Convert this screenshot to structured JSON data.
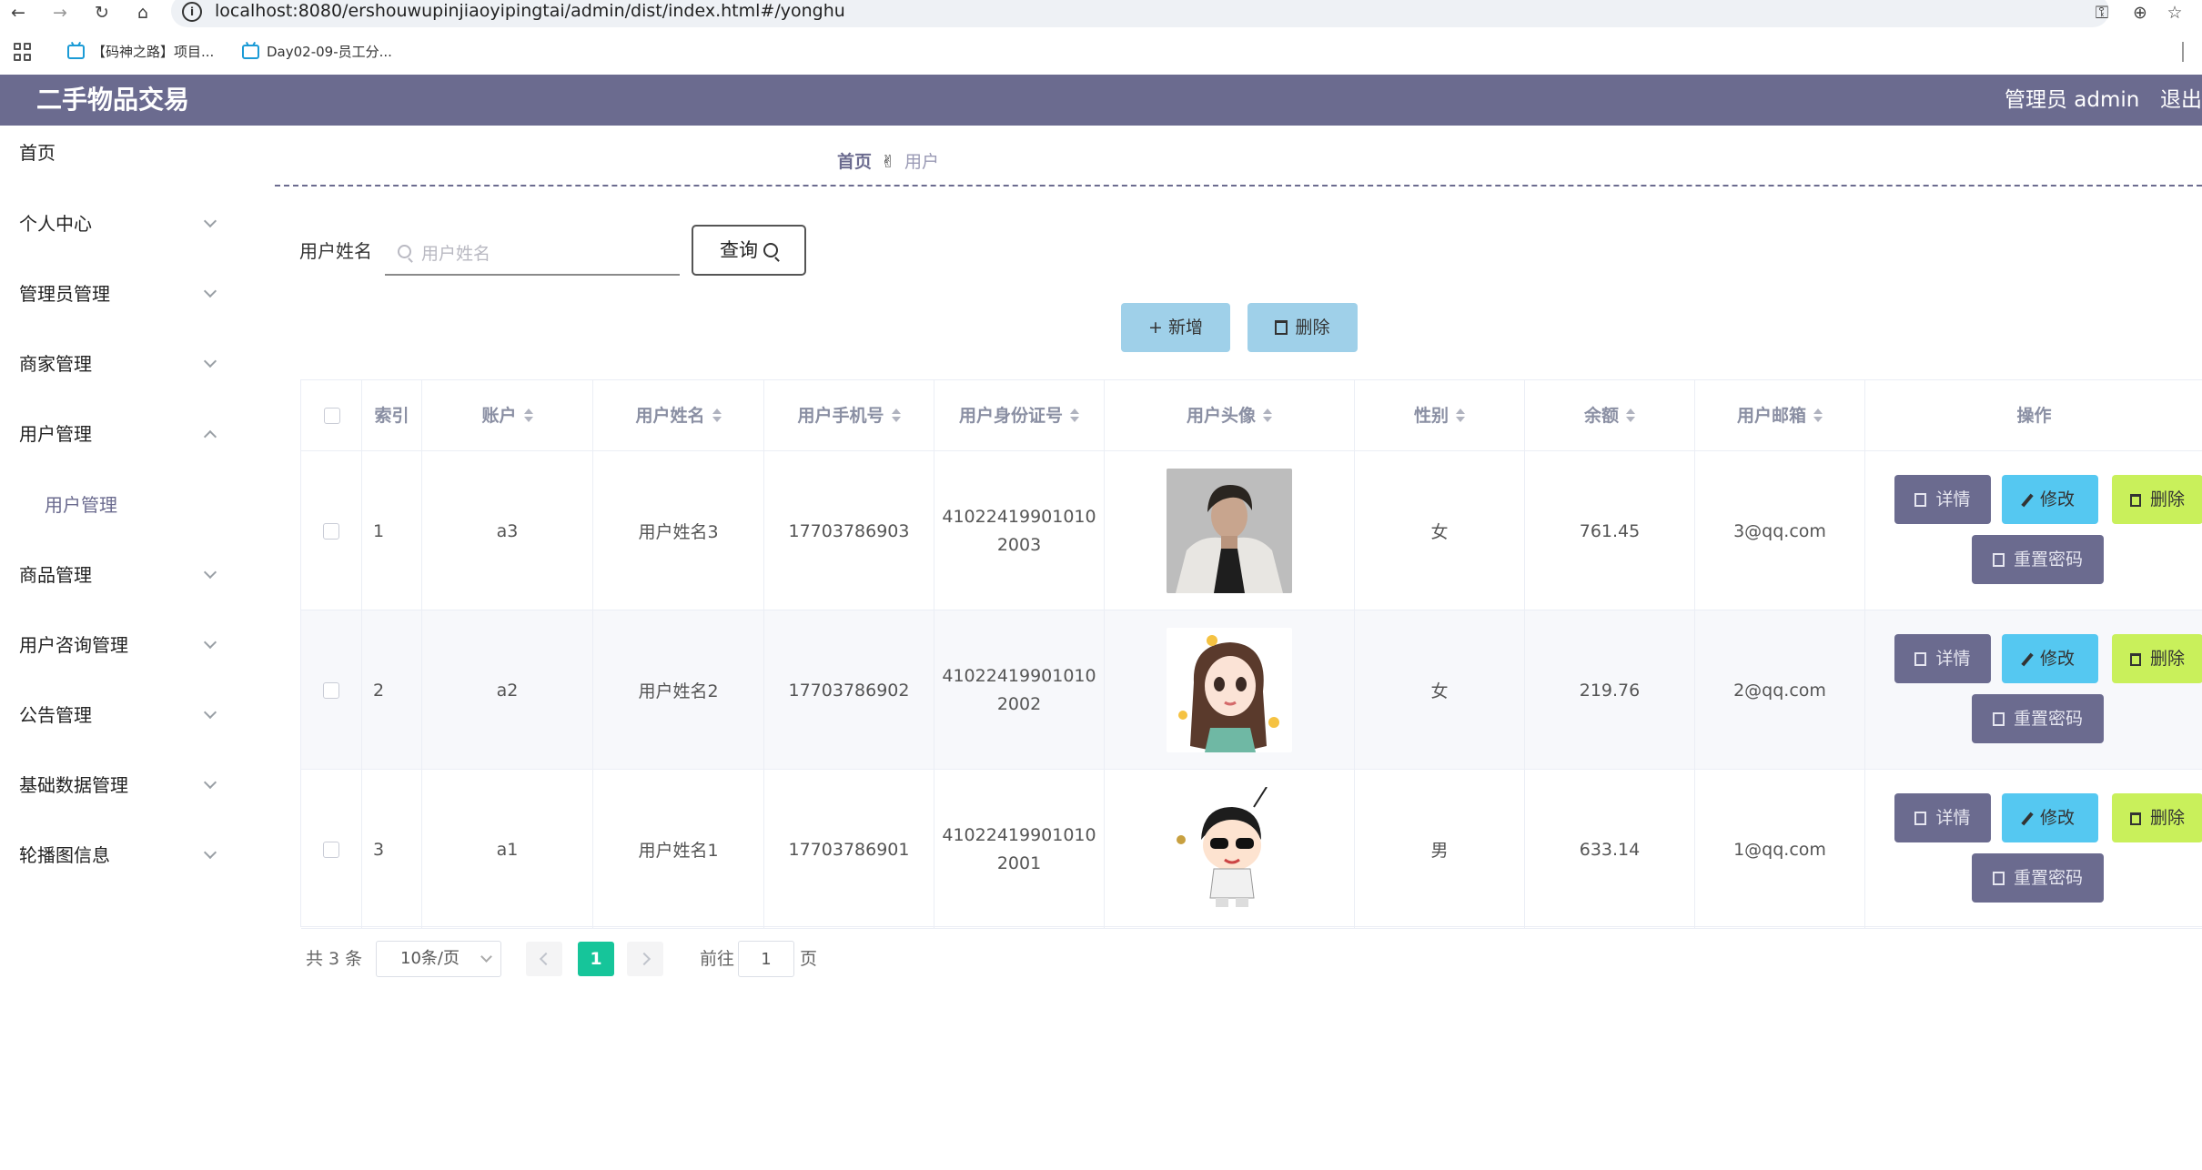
{
  "browser": {
    "url": "localhost:8080/ershouwupinjiaoyipingtai/admin/dist/index.html#/yonghu",
    "bookmarks": [
      {
        "label": "【码神之路】项目..."
      },
      {
        "label": "Day02-09-员工分..."
      }
    ]
  },
  "header": {
    "title": "二手物品交易",
    "admin_label": "管理员 admin",
    "logout_label": "退出"
  },
  "sidebar": {
    "items": [
      {
        "label": "首页"
      },
      {
        "label": "个人中心"
      },
      {
        "label": "管理员管理"
      },
      {
        "label": "商家管理"
      },
      {
        "label": "用户管理"
      },
      {
        "label": "商品管理"
      },
      {
        "label": "用户咨询管理"
      },
      {
        "label": "公告管理"
      },
      {
        "label": "基础数据管理"
      },
      {
        "label": "轮播图信息"
      }
    ],
    "submenu": {
      "label": "用户管理"
    }
  },
  "breadcrumb": {
    "home": "首页",
    "separator_glyph": "✌",
    "current": "用户"
  },
  "search": {
    "label": "用户姓名",
    "placeholder": "用户姓名",
    "query_label": "查询"
  },
  "actions": {
    "add_label": "新增",
    "delete_label": "删除"
  },
  "table": {
    "headers": {
      "index": "索引",
      "account": "账户",
      "name": "用户姓名",
      "phone": "用户手机号",
      "idcard": "用户身份证号",
      "avatar": "用户头像",
      "gender": "性别",
      "balance": "余额",
      "email": "用户邮箱",
      "ops": "操作"
    },
    "rows": [
      {
        "index": "1",
        "account": "a3",
        "name": "用户姓名3",
        "phone": "17703786903",
        "idcard_a": "41022419901010",
        "idcard_b": "2003",
        "gender": "女",
        "balance": "761.45",
        "email": "3@qq.com"
      },
      {
        "index": "2",
        "account": "a2",
        "name": "用户姓名2",
        "phone": "17703786902",
        "idcard_a": "41022419901010",
        "idcard_b": "2002",
        "gender": "女",
        "balance": "219.76",
        "email": "2@qq.com"
      },
      {
        "index": "3",
        "account": "a1",
        "name": "用户姓名1",
        "phone": "17703786901",
        "idcard_a": "41022419901010",
        "idcard_b": "2001",
        "gender": "男",
        "balance": "633.14",
        "email": "1@qq.com"
      }
    ],
    "op_labels": {
      "detail": "详情",
      "edit": "修改",
      "delete": "删除",
      "reset": "重置密码"
    }
  },
  "pagination": {
    "total": "共 3 条",
    "page_size": "10条/页",
    "current_page": "1",
    "goto_label": "前往",
    "goto_value": "1",
    "goto_suffix": "页"
  },
  "colors": {
    "header_bg": "#6b6b8f",
    "primary_btn": "#9fd0e9",
    "detail_btn": "#6b6b8f",
    "edit_btn": "#55c8f1",
    "delete_btn": "#c9f05b",
    "page_active": "#16c59a"
  }
}
